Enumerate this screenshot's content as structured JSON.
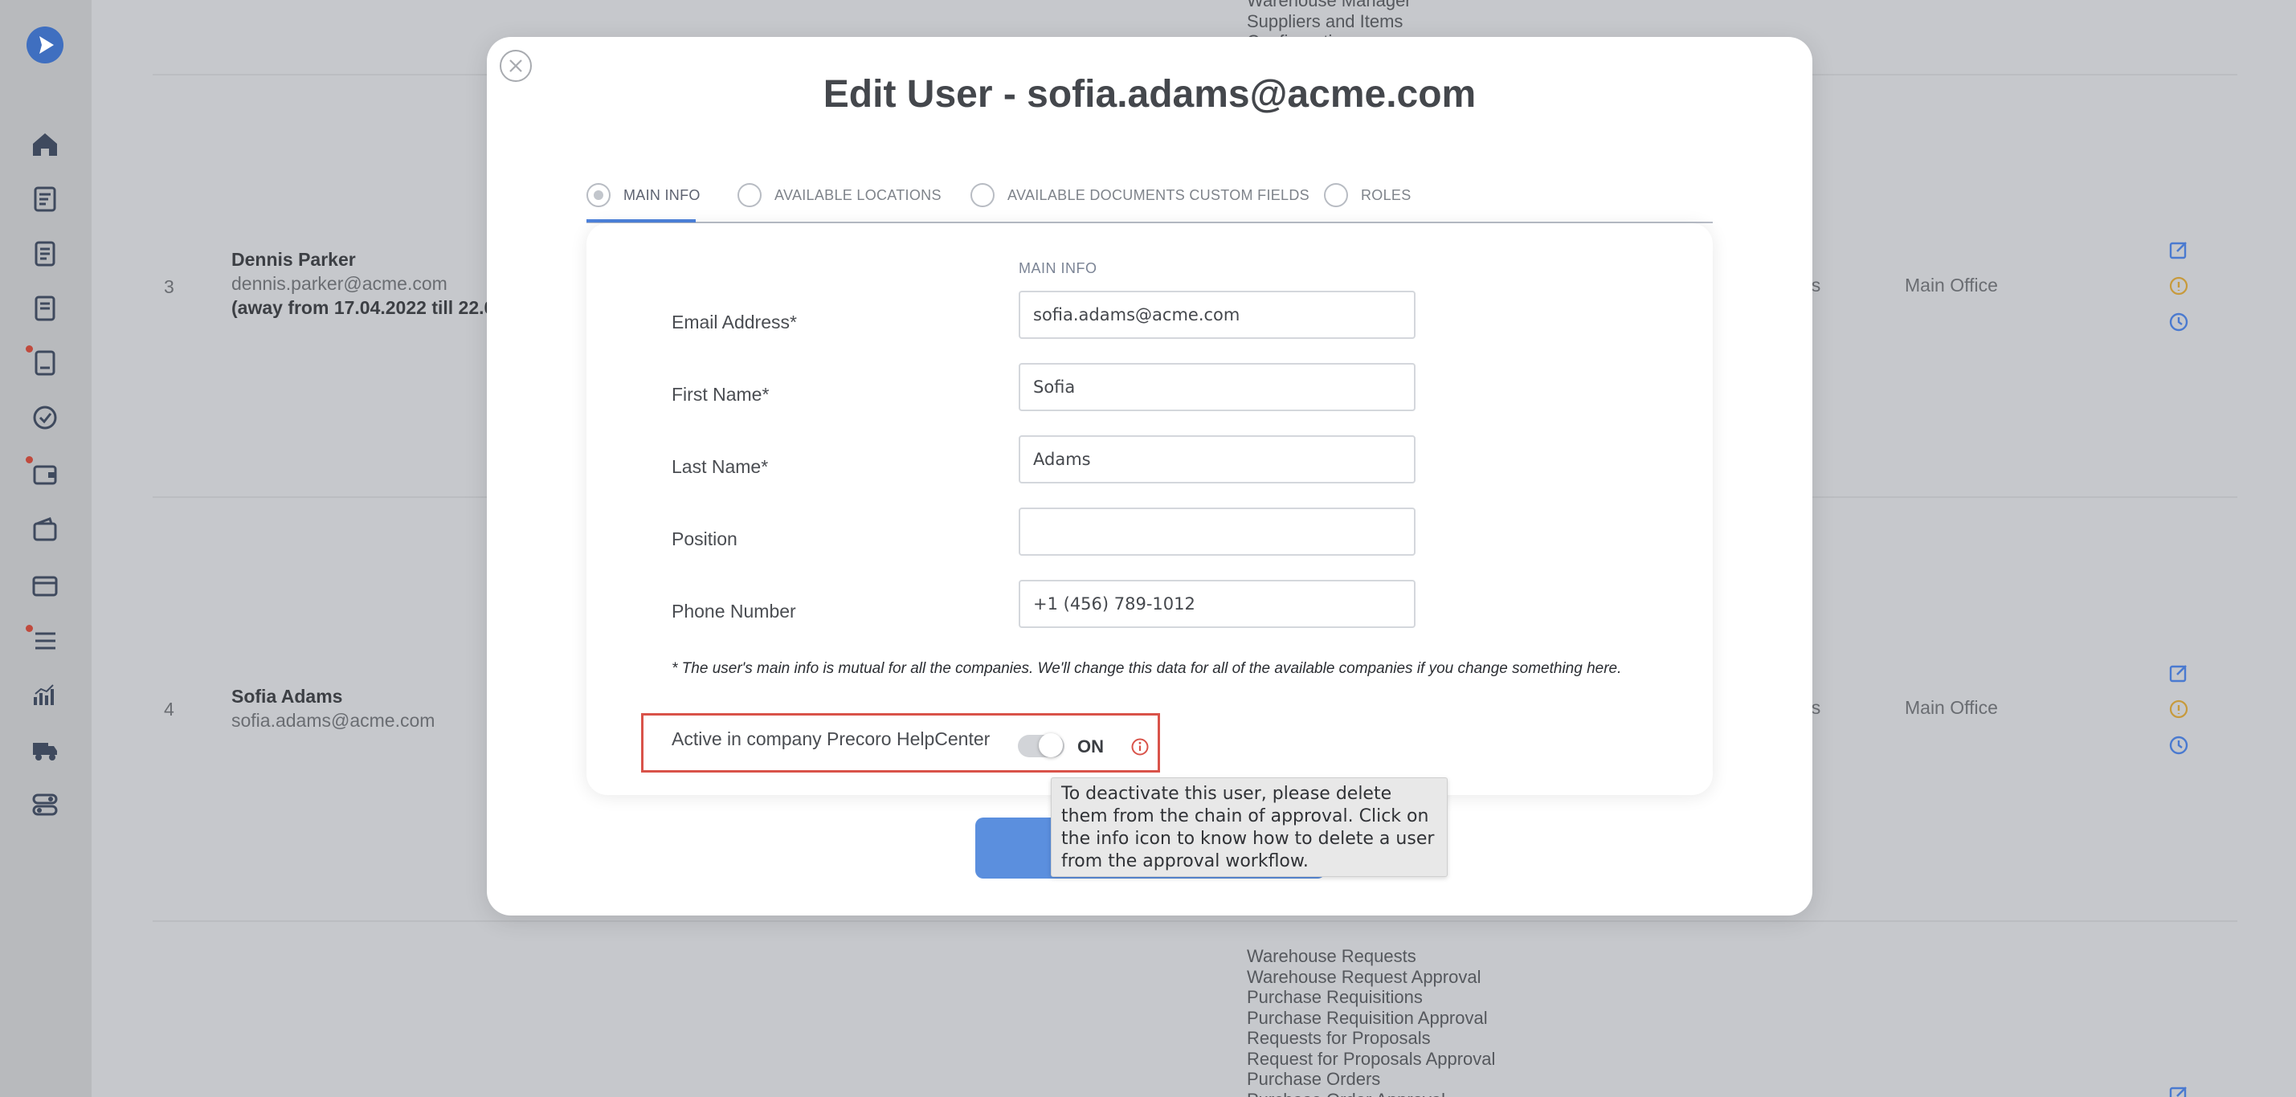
{
  "modal": {
    "title": "Edit User - sofia.adams@acme.com",
    "tabs": [
      {
        "label": "MAIN INFO",
        "active": true
      },
      {
        "label": "AVAILABLE LOCATIONS",
        "active": false
      },
      {
        "label": "AVAILABLE DOCUMENTS CUSTOM FIELDS",
        "active": false
      },
      {
        "label": "ROLES",
        "active": false
      }
    ],
    "section_heading": "MAIN INFO",
    "fields": {
      "email": {
        "label": "Email Address*",
        "value": "sofia.adams@acme.com"
      },
      "first_name": {
        "label": "First Name*",
        "value": "Sofia"
      },
      "last_name": {
        "label": "Last Name*",
        "value": "Adams"
      },
      "position": {
        "label": "Position",
        "value": ""
      },
      "phone": {
        "label": "Phone Number",
        "value": "+1 (456) 789-1012"
      }
    },
    "note": "* The user's main info is mutual for all the companies. We'll change this data for all of the available companies if you change something here.",
    "active_toggle": {
      "label": "Active in company Precoro HelpCenter",
      "state": "ON",
      "on": true
    },
    "tooltip": "To deactivate this user, please delete them from the chain of approval. Click on the info icon to know how to delete a user from the approval workflow."
  },
  "background": {
    "top_list": [
      "Warehouse Manager",
      "Suppliers and Items",
      "Configuration"
    ],
    "rows": [
      {
        "num": "3",
        "name": "Dennis Parker",
        "email": "dennis.parker@acme.com",
        "away": "(away from 17.04.2022 till 22.0",
        "role_tail": "es",
        "location": "Main Office"
      },
      {
        "num": "4",
        "name": "Sofia Adams",
        "email": "sofia.adams@acme.com",
        "away": "",
        "role_tail": "es",
        "location": "Main Office"
      }
    ],
    "bottom_list": [
      "Warehouse Requests",
      "Warehouse Request Approval",
      "Purchase Requisitions",
      "Purchase Requisition Approval",
      "Requests for Proposals",
      "Request for Proposals Approval",
      "Purchase Orders",
      "Purchase Order Approval"
    ]
  },
  "colors": {
    "accent": "#4d82dc",
    "save_button": "#5b8fde",
    "highlight_border": "#d9534a",
    "overlay": "#c6c8cc"
  },
  "icons": {
    "close": "close-icon",
    "info": "info-icon"
  }
}
